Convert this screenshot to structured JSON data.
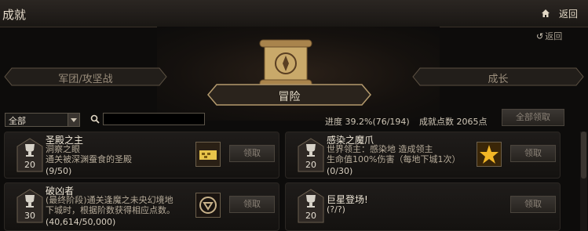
{
  "window": {
    "title": "成就",
    "back_label": "返回"
  },
  "sub_back": {
    "label": "返回"
  },
  "categories": {
    "left": "军团/攻坚战",
    "center": "冒险",
    "right": "成长"
  },
  "filter": {
    "selected": "全部",
    "search_placeholder": ""
  },
  "stats": {
    "progress": "进度 39.2%(76/194)",
    "points": "成就点数 2065点",
    "claim_all": "全部领取"
  },
  "achievements": [
    {
      "points": "20",
      "title": "圣殿之主",
      "desc1": "洞察之眼",
      "desc2": "通关被深渊蚕食的圣殿",
      "progress": "(9/50)",
      "claim": "领取",
      "reward_icon": "gold-stack-icon"
    },
    {
      "points": "20",
      "title": "感染之魔爪",
      "desc1": "世界领主：感染地    造成领主",
      "desc2": "生命值100%伤害（每地下城1次）",
      "progress": "(0/30)",
      "claim": "领取",
      "reward_icon": "star-burst-icon"
    },
    {
      "points": "30",
      "title": "破凶者",
      "desc1": "(最终阶段)通关逢魔之未央幻境地",
      "desc2": "下城时，根据阶数获得相应点数。",
      "progress": "(40,614/50,000)",
      "claim": "领取",
      "reward_icon": "emblem-icon"
    },
    {
      "points": "20",
      "title": "巨星登场!",
      "desc1": "",
      "desc2": "",
      "progress": "(?/?)",
      "claim": "领取",
      "reward_icon": ""
    }
  ]
}
